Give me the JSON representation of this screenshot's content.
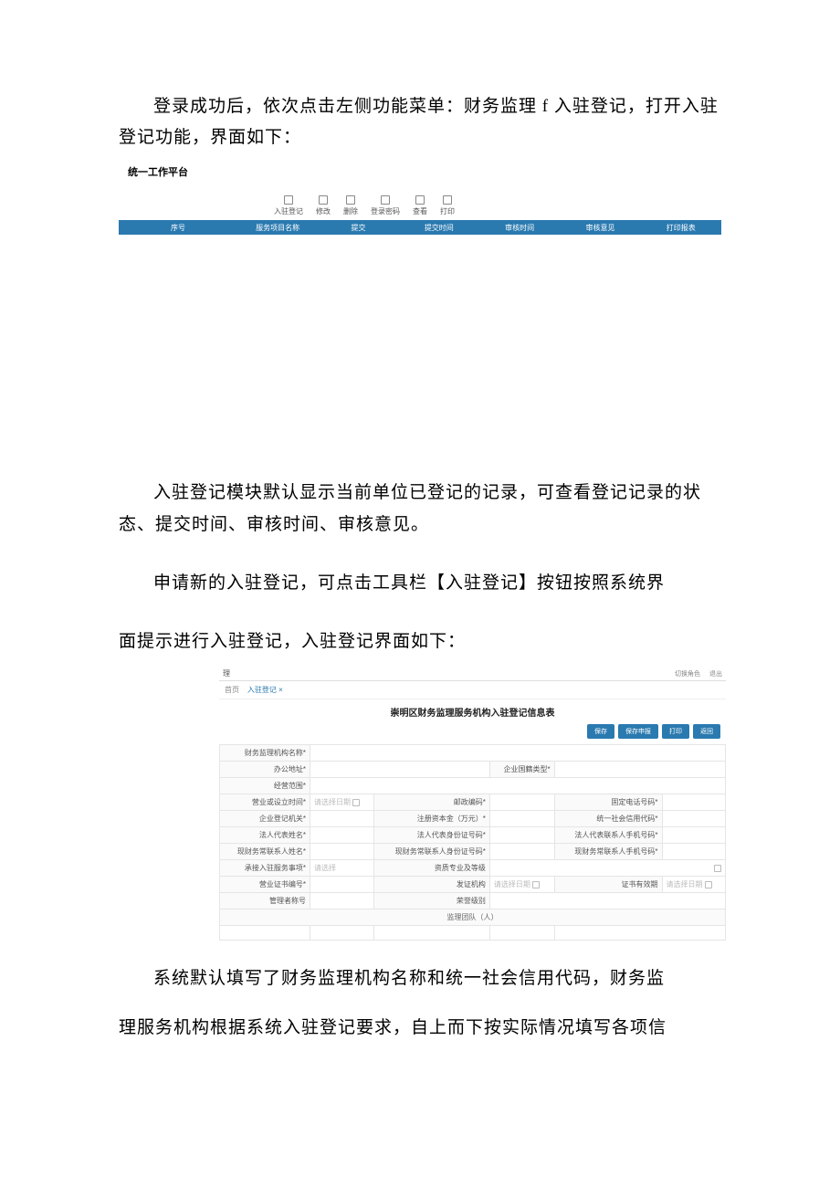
{
  "doc": {
    "p1": "登录成功后，依次点击左侧功能菜单：财务监理 f 入驻登记，打开入驻登记功能，界面如下：",
    "p2": "入驻登记模块默认显示当前单位已登记的记录，可查看登记记录的状态、提交时间、审核时间、审核意见。",
    "p3": "申请新的入驻登记，可点击工具栏【入驻登记】按钮按照系统界",
    "p4": "面提示进行入驻登记，入驻登记界面如下：",
    "p5": "系统默认填写了财务监理机构名称和统一社会信用代码，财务监",
    "p6": "理服务机构根据系统入驻登记要求，自上而下按实际情况填写各项信"
  },
  "shot1": {
    "appname": "统一工作平台",
    "toolbar": [
      "入驻登记",
      "修改",
      "删除",
      "登录密码",
      "查看",
      "打印"
    ],
    "columns": [
      "序号",
      "服务项目名称",
      "提交",
      "提交时间",
      "审核时间",
      "审核意见",
      "打印报表"
    ]
  },
  "shot2": {
    "logo": "理",
    "topright": [
      "",
      "",
      " 切换角色",
      "退出"
    ],
    "crumb_home": "首页",
    "crumb_link": "入驻登记 ×",
    "title": "崇明区财务监理服务机构入驻登记信息表",
    "buttons": [
      "保存",
      "保存申报",
      "打印",
      "返回"
    ],
    "fields": {
      "org_name": "财务监理机构名称*",
      "addr": "办公地址*",
      "post": "经营范围*",
      "est_date": "营业或设立时间*",
      "est_date_ph": "请选择日期",
      "zip": "邮政编码*",
      "tel": "固定电话号码*",
      "firm_type": "企业登记机关*",
      "reg_cap": "注册资本金（万元）*",
      "uscc": "统一社会信用代码*",
      "uscc_val": "",
      "legal": "法人代表姓名*",
      "legal_id": "法人代表身份证号码*",
      "legal_mobile": "法人代表联系人手机号码*",
      "svc_contact": "现财务常联系人姓名*",
      "svc_contact_id": "现财务常联系人身份证号码*",
      "svc_contact_mobile": "现财务常联系人手机号码*",
      "svc_items": "承接入驻服务事项*",
      "svc_items_ph": "请选择",
      "svc_major": "资质专业及等级",
      "cert_no": "营业证书编号*",
      "issue_org": "发证机构",
      "issue_date_ph": "请选择日期",
      "expire": "证书有效期",
      "expire_ph": "请选择日期",
      "mgr_cert": "管理者称号",
      "honor": "荣誉级别",
      "team_section": "监理团队（人）",
      "sub_cols": [
        "",
        "",
        "",
        "",
        ""
      ]
    }
  }
}
